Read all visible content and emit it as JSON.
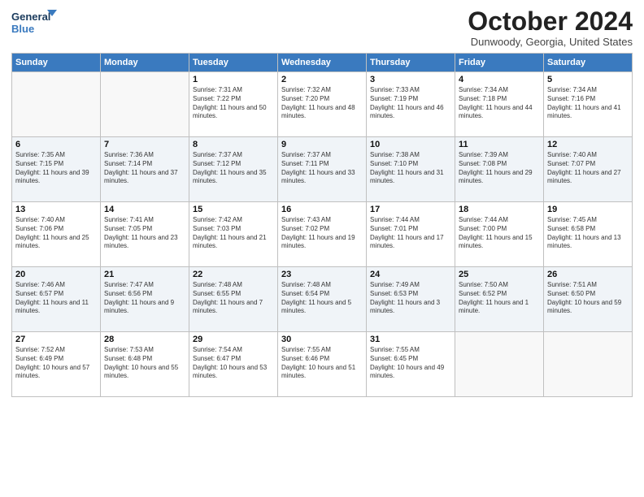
{
  "header": {
    "logo_line1": "General",
    "logo_line2": "Blue",
    "title": "October 2024",
    "location": "Dunwoody, Georgia, United States"
  },
  "days_of_week": [
    "Sunday",
    "Monday",
    "Tuesday",
    "Wednesday",
    "Thursday",
    "Friday",
    "Saturday"
  ],
  "weeks": [
    [
      {
        "day": "",
        "sunrise": "",
        "sunset": "",
        "daylight": ""
      },
      {
        "day": "",
        "sunrise": "",
        "sunset": "",
        "daylight": ""
      },
      {
        "day": "1",
        "sunrise": "Sunrise: 7:31 AM",
        "sunset": "Sunset: 7:22 PM",
        "daylight": "Daylight: 11 hours and 50 minutes."
      },
      {
        "day": "2",
        "sunrise": "Sunrise: 7:32 AM",
        "sunset": "Sunset: 7:20 PM",
        "daylight": "Daylight: 11 hours and 48 minutes."
      },
      {
        "day": "3",
        "sunrise": "Sunrise: 7:33 AM",
        "sunset": "Sunset: 7:19 PM",
        "daylight": "Daylight: 11 hours and 46 minutes."
      },
      {
        "day": "4",
        "sunrise": "Sunrise: 7:34 AM",
        "sunset": "Sunset: 7:18 PM",
        "daylight": "Daylight: 11 hours and 44 minutes."
      },
      {
        "day": "5",
        "sunrise": "Sunrise: 7:34 AM",
        "sunset": "Sunset: 7:16 PM",
        "daylight": "Daylight: 11 hours and 41 minutes."
      }
    ],
    [
      {
        "day": "6",
        "sunrise": "Sunrise: 7:35 AM",
        "sunset": "Sunset: 7:15 PM",
        "daylight": "Daylight: 11 hours and 39 minutes."
      },
      {
        "day": "7",
        "sunrise": "Sunrise: 7:36 AM",
        "sunset": "Sunset: 7:14 PM",
        "daylight": "Daylight: 11 hours and 37 minutes."
      },
      {
        "day": "8",
        "sunrise": "Sunrise: 7:37 AM",
        "sunset": "Sunset: 7:12 PM",
        "daylight": "Daylight: 11 hours and 35 minutes."
      },
      {
        "day": "9",
        "sunrise": "Sunrise: 7:37 AM",
        "sunset": "Sunset: 7:11 PM",
        "daylight": "Daylight: 11 hours and 33 minutes."
      },
      {
        "day": "10",
        "sunrise": "Sunrise: 7:38 AM",
        "sunset": "Sunset: 7:10 PM",
        "daylight": "Daylight: 11 hours and 31 minutes."
      },
      {
        "day": "11",
        "sunrise": "Sunrise: 7:39 AM",
        "sunset": "Sunset: 7:08 PM",
        "daylight": "Daylight: 11 hours and 29 minutes."
      },
      {
        "day": "12",
        "sunrise": "Sunrise: 7:40 AM",
        "sunset": "Sunset: 7:07 PM",
        "daylight": "Daylight: 11 hours and 27 minutes."
      }
    ],
    [
      {
        "day": "13",
        "sunrise": "Sunrise: 7:40 AM",
        "sunset": "Sunset: 7:06 PM",
        "daylight": "Daylight: 11 hours and 25 minutes."
      },
      {
        "day": "14",
        "sunrise": "Sunrise: 7:41 AM",
        "sunset": "Sunset: 7:05 PM",
        "daylight": "Daylight: 11 hours and 23 minutes."
      },
      {
        "day": "15",
        "sunrise": "Sunrise: 7:42 AM",
        "sunset": "Sunset: 7:03 PM",
        "daylight": "Daylight: 11 hours and 21 minutes."
      },
      {
        "day": "16",
        "sunrise": "Sunrise: 7:43 AM",
        "sunset": "Sunset: 7:02 PM",
        "daylight": "Daylight: 11 hours and 19 minutes."
      },
      {
        "day": "17",
        "sunrise": "Sunrise: 7:44 AM",
        "sunset": "Sunset: 7:01 PM",
        "daylight": "Daylight: 11 hours and 17 minutes."
      },
      {
        "day": "18",
        "sunrise": "Sunrise: 7:44 AM",
        "sunset": "Sunset: 7:00 PM",
        "daylight": "Daylight: 11 hours and 15 minutes."
      },
      {
        "day": "19",
        "sunrise": "Sunrise: 7:45 AM",
        "sunset": "Sunset: 6:58 PM",
        "daylight": "Daylight: 11 hours and 13 minutes."
      }
    ],
    [
      {
        "day": "20",
        "sunrise": "Sunrise: 7:46 AM",
        "sunset": "Sunset: 6:57 PM",
        "daylight": "Daylight: 11 hours and 11 minutes."
      },
      {
        "day": "21",
        "sunrise": "Sunrise: 7:47 AM",
        "sunset": "Sunset: 6:56 PM",
        "daylight": "Daylight: 11 hours and 9 minutes."
      },
      {
        "day": "22",
        "sunrise": "Sunrise: 7:48 AM",
        "sunset": "Sunset: 6:55 PM",
        "daylight": "Daylight: 11 hours and 7 minutes."
      },
      {
        "day": "23",
        "sunrise": "Sunrise: 7:48 AM",
        "sunset": "Sunset: 6:54 PM",
        "daylight": "Daylight: 11 hours and 5 minutes."
      },
      {
        "day": "24",
        "sunrise": "Sunrise: 7:49 AM",
        "sunset": "Sunset: 6:53 PM",
        "daylight": "Daylight: 11 hours and 3 minutes."
      },
      {
        "day": "25",
        "sunrise": "Sunrise: 7:50 AM",
        "sunset": "Sunset: 6:52 PM",
        "daylight": "Daylight: 11 hours and 1 minute."
      },
      {
        "day": "26",
        "sunrise": "Sunrise: 7:51 AM",
        "sunset": "Sunset: 6:50 PM",
        "daylight": "Daylight: 10 hours and 59 minutes."
      }
    ],
    [
      {
        "day": "27",
        "sunrise": "Sunrise: 7:52 AM",
        "sunset": "Sunset: 6:49 PM",
        "daylight": "Daylight: 10 hours and 57 minutes."
      },
      {
        "day": "28",
        "sunrise": "Sunrise: 7:53 AM",
        "sunset": "Sunset: 6:48 PM",
        "daylight": "Daylight: 10 hours and 55 minutes."
      },
      {
        "day": "29",
        "sunrise": "Sunrise: 7:54 AM",
        "sunset": "Sunset: 6:47 PM",
        "daylight": "Daylight: 10 hours and 53 minutes."
      },
      {
        "day": "30",
        "sunrise": "Sunrise: 7:55 AM",
        "sunset": "Sunset: 6:46 PM",
        "daylight": "Daylight: 10 hours and 51 minutes."
      },
      {
        "day": "31",
        "sunrise": "Sunrise: 7:55 AM",
        "sunset": "Sunset: 6:45 PM",
        "daylight": "Daylight: 10 hours and 49 minutes."
      },
      {
        "day": "",
        "sunrise": "",
        "sunset": "",
        "daylight": ""
      },
      {
        "day": "",
        "sunrise": "",
        "sunset": "",
        "daylight": ""
      }
    ]
  ]
}
